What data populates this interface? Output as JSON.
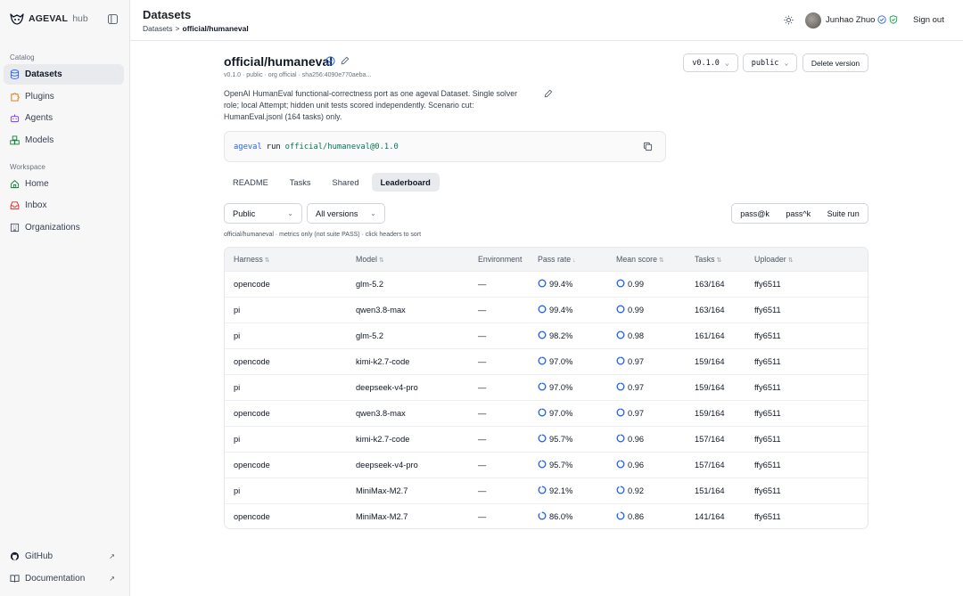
{
  "app": {
    "name": "AGEVAL",
    "suffix": "hub"
  },
  "sidebar": {
    "catalog_label": "Catalog",
    "catalog_items": [
      {
        "label": "Datasets",
        "icon": "database-icon",
        "active": true
      },
      {
        "label": "Plugins",
        "icon": "puzzle-icon"
      },
      {
        "label": "Agents",
        "icon": "bot-icon"
      },
      {
        "label": "Models",
        "icon": "boxes-icon"
      }
    ],
    "workspace_label": "Workspace",
    "workspace_items": [
      {
        "label": "Home",
        "icon": "home-icon"
      },
      {
        "label": "Inbox",
        "icon": "inbox-icon"
      },
      {
        "label": "Organizations",
        "icon": "building-icon"
      }
    ],
    "footer_items": [
      {
        "label": "GitHub",
        "icon": "github-icon",
        "arrow": "↗"
      },
      {
        "label": "Documentation",
        "icon": "book-icon",
        "arrow": "↗"
      }
    ]
  },
  "header": {
    "title": "Datasets",
    "breadcrumb": {
      "parent": "Datasets",
      "separator": ">",
      "current": "official/humaneval"
    },
    "user_name": "Junhao Zhuo",
    "sign_out": "Sign out"
  },
  "dataset": {
    "name": "official/humaneval",
    "meta": "v0.1.0 · public · org official · sha256:4090e770aeba...",
    "description": "OpenAI HumanEval functional-correctness port as one ageval Dataset. Single solver role; local Attempt; hidden unit tests scored independently. Scenario cut: HumanEval.jsonl (164 tasks) only.",
    "version_select": "v0.1.0",
    "visibility_select": "public",
    "delete_label": "Delete version",
    "command": {
      "cmd": "ageval",
      "sub": "run",
      "target": "official/humaneval@0.1.0"
    }
  },
  "tabs": [
    "README",
    "Tasks",
    "Shared",
    "Leaderboard"
  ],
  "active_tab": "Leaderboard",
  "filters": {
    "scope": "Public",
    "versions": "All versions",
    "metrics": [
      "pass@k",
      "pass^k",
      "Suite run"
    ]
  },
  "note": "official/humaneval · metrics only (not suite PASS) · click headers to sort",
  "table": {
    "columns": [
      {
        "label": "Harness",
        "sort": "⇅"
      },
      {
        "label": "Model",
        "sort": "⇅"
      },
      {
        "label": "Environment",
        "sort": ""
      },
      {
        "label": "Pass rate",
        "sort": "↓"
      },
      {
        "label": "Mean score",
        "sort": "⇅"
      },
      {
        "label": "Tasks",
        "sort": "⇅"
      },
      {
        "label": "Uploader",
        "sort": "⇅"
      }
    ],
    "rows": [
      {
        "harness": "opencode",
        "model": "glm-5.2",
        "env": "—",
        "pass_rate": "99.4%",
        "pass_frac": 0.994,
        "mean": "0.99",
        "mean_frac": 0.99,
        "tasks": "163/164",
        "uploader": "ffy6511"
      },
      {
        "harness": "pi",
        "model": "qwen3.8-max",
        "env": "—",
        "pass_rate": "99.4%",
        "pass_frac": 0.994,
        "mean": "0.99",
        "mean_frac": 0.99,
        "tasks": "163/164",
        "uploader": "ffy6511"
      },
      {
        "harness": "pi",
        "model": "glm-5.2",
        "env": "—",
        "pass_rate": "98.2%",
        "pass_frac": 0.982,
        "mean": "0.98",
        "mean_frac": 0.98,
        "tasks": "161/164",
        "uploader": "ffy6511"
      },
      {
        "harness": "opencode",
        "model": "kimi-k2.7-code",
        "env": "—",
        "pass_rate": "97.0%",
        "pass_frac": 0.97,
        "mean": "0.97",
        "mean_frac": 0.97,
        "tasks": "159/164",
        "uploader": "ffy6511"
      },
      {
        "harness": "pi",
        "model": "deepseek-v4-pro",
        "env": "—",
        "pass_rate": "97.0%",
        "pass_frac": 0.97,
        "mean": "0.97",
        "mean_frac": 0.97,
        "tasks": "159/164",
        "uploader": "ffy6511"
      },
      {
        "harness": "opencode",
        "model": "qwen3.8-max",
        "env": "—",
        "pass_rate": "97.0%",
        "pass_frac": 0.97,
        "mean": "0.97",
        "mean_frac": 0.97,
        "tasks": "159/164",
        "uploader": "ffy6511"
      },
      {
        "harness": "pi",
        "model": "kimi-k2.7-code",
        "env": "—",
        "pass_rate": "95.7%",
        "pass_frac": 0.957,
        "mean": "0.96",
        "mean_frac": 0.96,
        "tasks": "157/164",
        "uploader": "ffy6511"
      },
      {
        "harness": "opencode",
        "model": "deepseek-v4-pro",
        "env": "—",
        "pass_rate": "95.7%",
        "pass_frac": 0.957,
        "mean": "0.96",
        "mean_frac": 0.96,
        "tasks": "157/164",
        "uploader": "ffy6511"
      },
      {
        "harness": "pi",
        "model": "MiniMax-M2.7",
        "env": "—",
        "pass_rate": "92.1%",
        "pass_frac": 0.921,
        "mean": "0.92",
        "mean_frac": 0.92,
        "tasks": "151/164",
        "uploader": "ffy6511"
      },
      {
        "harness": "opencode",
        "model": "MiniMax-M2.7",
        "env": "—",
        "pass_rate": "86.0%",
        "pass_frac": 0.86,
        "mean": "0.86",
        "mean_frac": 0.86,
        "tasks": "141/164",
        "uploader": "ffy6511"
      }
    ]
  },
  "colors": {
    "accent": "#2563eb",
    "code_green": "#047857",
    "ring_track": "#dbe3f0"
  }
}
